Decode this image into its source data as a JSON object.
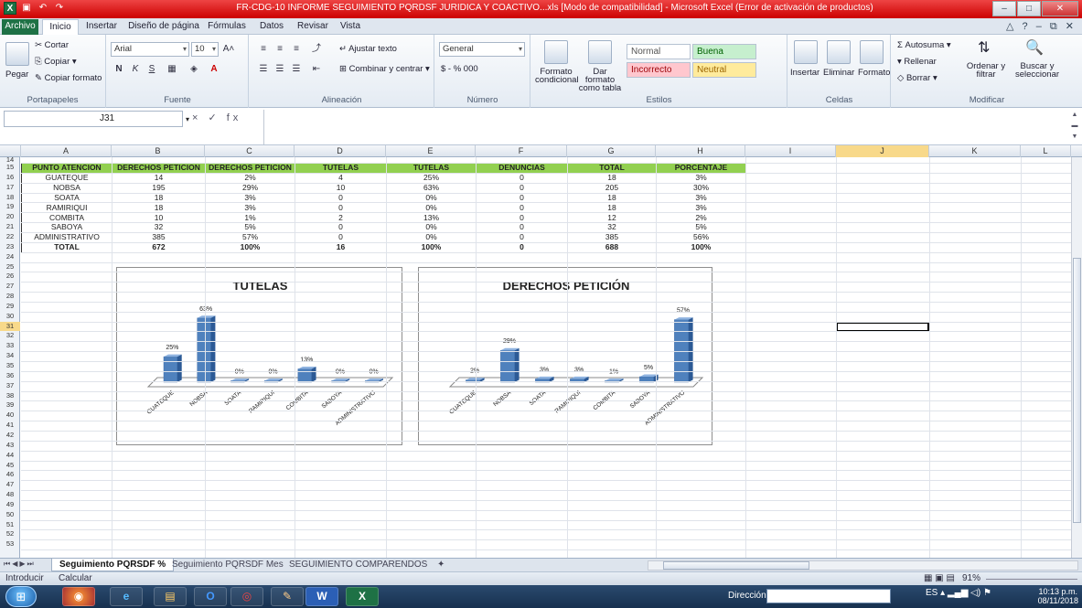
{
  "window": {
    "title": "FR-CDG-10 INFORME SEGUIMIENTO PQRDSF JURIDICA Y COACTIVO...xls [Modo de compatibilidad] - Microsoft Excel (Error de activación de productos)",
    "app_icon": "X"
  },
  "ribbon_tabs": [
    "Archivo",
    "Inicio",
    "Insertar",
    "Diseño de página",
    "Fórmulas",
    "Datos",
    "Revisar",
    "Vista"
  ],
  "ribbon": {
    "clipboard": {
      "paste": "Pegar",
      "cut": "Cortar",
      "copy": "Copiar",
      "format_painter": "Copiar formato",
      "label": "Portapapeles"
    },
    "font": {
      "font_name": "Arial",
      "font_size": "10",
      "label": "Fuente"
    },
    "alignment": {
      "wrap_text": "Ajustar texto",
      "merge_center": "Combinar y centrar",
      "label": "Alineación"
    },
    "number": {
      "format": "General",
      "currency": "$ - % 000",
      "label": "Número"
    },
    "styles": {
      "conditional": "Formato condicional",
      "as_table": "Dar formato como tabla",
      "cells": [
        "Normal",
        "Buena",
        "Incorrecto",
        "Neutral"
      ],
      "label": "Estilos"
    },
    "cells": {
      "insert": "Insertar",
      "delete": "Eliminar",
      "format": "Formato",
      "label": "Celdas"
    },
    "editing": {
      "autosum": "Autosuma",
      "fill": "Rellenar",
      "clear": "Borrar",
      "sort": "Ordenar y filtrar",
      "find": "Buscar y seleccionar",
      "label": "Modificar"
    }
  },
  "formula_bar": {
    "name_box": "J31",
    "fx_symbols": "× ✓ fx",
    "formula": ""
  },
  "sheet": {
    "columns": [
      "A",
      "B",
      "C",
      "D",
      "E",
      "F",
      "G",
      "H",
      "I",
      "J",
      "K",
      "L"
    ],
    "selected_column": "J",
    "rows": [
      "14",
      "15",
      "16",
      "17",
      "18",
      "19",
      "20",
      "21",
      "22",
      "23",
      "24",
      "25",
      "26",
      "27",
      "28",
      "29",
      "30",
      "31",
      "32",
      "33",
      "34",
      "35",
      "36",
      "37",
      "38",
      "39",
      "40",
      "41",
      "42",
      "43",
      "44",
      "45",
      "46",
      "47",
      "48",
      "49",
      "50",
      "51",
      "52",
      "53"
    ],
    "selected_row": "31",
    "table": {
      "headers": [
        "PUNTO ATENCION",
        "DERECHOS PETICION",
        "DERECHOS PETICION",
        "TUTELAS",
        "TUTELAS",
        "DENUNCIAS",
        "TOTAL",
        "PORCENTAJE"
      ],
      "rows": [
        [
          "GUATEQUE",
          "14",
          "2%",
          "4",
          "25%",
          "0",
          "18",
          "3%"
        ],
        [
          "NOBSA",
          "195",
          "29%",
          "10",
          "63%",
          "0",
          "205",
          "30%"
        ],
        [
          "SOATA",
          "18",
          "3%",
          "0",
          "0%",
          "0",
          "18",
          "3%"
        ],
        [
          "RAMIRIQUI",
          "18",
          "3%",
          "0",
          "0%",
          "0",
          "18",
          "3%"
        ],
        [
          "COMBITA",
          "10",
          "1%",
          "2",
          "13%",
          "0",
          "12",
          "2%"
        ],
        [
          "SABOYA",
          "32",
          "5%",
          "0",
          "0%",
          "0",
          "32",
          "5%"
        ],
        [
          "ADMINISTRATIVO",
          "385",
          "57%",
          "0",
          "0%",
          "0",
          "385",
          "56%"
        ]
      ],
      "total": [
        "TOTAL",
        "672",
        "100%",
        "16",
        "100%",
        "0",
        "688",
        "100%"
      ]
    }
  },
  "chart_data": [
    {
      "type": "bar",
      "title": "TUTELAS",
      "categories": [
        "GUATEQUE",
        "NOBSA",
        "SOATA",
        "RAMIRIQUI",
        "COMBITA",
        "SABOYA",
        "ADMINISTRATIVO"
      ],
      "values": [
        25,
        63,
        0,
        0,
        13,
        0,
        0
      ],
      "data_labels": [
        "25%",
        "63%",
        "0%",
        "0%",
        "13%",
        "0%",
        "0%"
      ],
      "ylim": [
        0,
        70
      ],
      "grid": false,
      "color": "#4f81bd"
    },
    {
      "type": "bar",
      "title": "DERECHOS PETICIÓN",
      "categories": [
        "GUATEQUE",
        "NOBSA",
        "SOATA",
        "RAMIRIQUI",
        "COMBITA",
        "SABOYA",
        "ADMINISTRATIVO"
      ],
      "values": [
        2,
        29,
        3,
        3,
        1,
        5,
        57
      ],
      "data_labels": [
        "2%",
        "29%",
        "3%",
        "3%",
        "1%",
        "5%",
        "57%"
      ],
      "ylim": [
        0,
        65
      ],
      "grid": false,
      "color": "#4f81bd"
    }
  ],
  "sheet_tabs": [
    "Seguimiento PQRSDF %",
    "Seguimiento PQRSDF Mes",
    "SEGUIMIENTO COMPARENDOS"
  ],
  "status": {
    "mode": "Introducir",
    "calc": "Calcular",
    "zoom": "91%"
  },
  "taskbar": {
    "apps": [
      "firefox",
      "ie",
      "explorer",
      "outlook",
      "chrome",
      "paint",
      "word",
      "excel"
    ],
    "address_label": "Dirección",
    "language": "ES",
    "time": "10:13 p.m.",
    "date": "08/11/2018"
  }
}
